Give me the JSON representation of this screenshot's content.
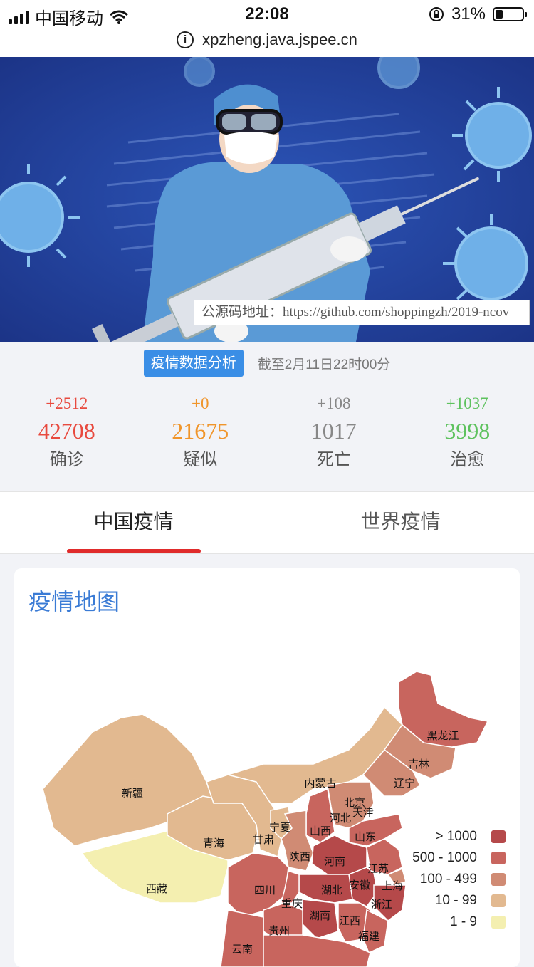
{
  "status_bar": {
    "carrier": "中国移动",
    "time": "22:08",
    "battery": "31%"
  },
  "url": "xpzheng.java.jspee.cn",
  "banner": {
    "source_label": "公源码地址：https://github.com/shoppingzh/2019-ncov"
  },
  "summary": {
    "tag": "疫情数据分析",
    "as_of": "截至2月11日22时00分",
    "stats": [
      {
        "increment": "+2512",
        "value": "42708",
        "label": "确诊",
        "color": "#e84a3f"
      },
      {
        "increment": "+0",
        "value": "21675",
        "label": "疑似",
        "color": "#f0952b"
      },
      {
        "increment": "+108",
        "value": "1017",
        "label": "死亡",
        "color": "#888888"
      },
      {
        "increment": "+1037",
        "value": "3998",
        "label": "治愈",
        "color": "#5ec25e"
      }
    ]
  },
  "tabs": [
    {
      "label": "中国疫情",
      "active": true
    },
    {
      "label": "世界疫情",
      "active": false
    }
  ],
  "map_card": {
    "title": "疫情地图",
    "provinces": [
      "黑龙江",
      "吉林",
      "辽宁",
      "内蒙古",
      "北京",
      "天津",
      "河北",
      "山西",
      "山东",
      "新疆",
      "宁夏",
      "甘肃",
      "青海",
      "陕西",
      "河南",
      "江苏",
      "西藏",
      "四川",
      "重庆",
      "湖北",
      "安徽",
      "上海",
      "浙江",
      "湖南",
      "江西",
      "贵州",
      "福建",
      "云南"
    ],
    "legend": [
      {
        "label": "> 1000",
        "color": "#b5494a"
      },
      {
        "label": "500 - 1000",
        "color": "#c8655e"
      },
      {
        "label": "100 - 499",
        "color": "#d08b74"
      },
      {
        "label": "10 - 99",
        "color": "#e2b990"
      },
      {
        "label": "1 - 9",
        "color": "#f4efb0"
      }
    ]
  },
  "colors": {
    "accent_blue": "#3a8ee6",
    "tab_underline": "#e02b2b"
  }
}
